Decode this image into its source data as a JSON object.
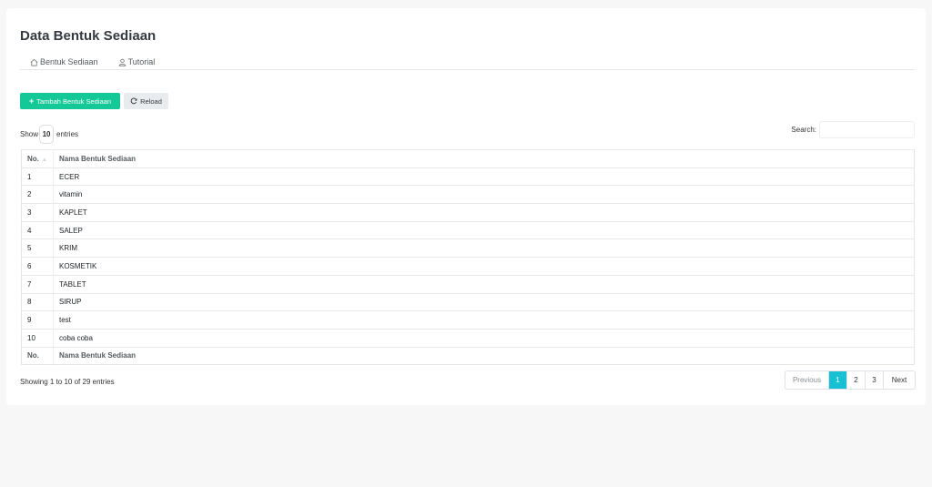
{
  "page": {
    "title": "Data Bentuk Sediaan"
  },
  "breadcrumb": [
    {
      "label": "Bentuk Sediaan",
      "icon": "home-icon"
    },
    {
      "label": "Tutorial",
      "icon": "user-icon"
    }
  ],
  "toolbar": {
    "add_label": "Tambah Bentuk Sediaan",
    "reload_label": "Reload"
  },
  "length": {
    "prefix": "Show",
    "value": "10",
    "suffix": "entries"
  },
  "search": {
    "label": "Search:",
    "value": ""
  },
  "table": {
    "headers": [
      "No.",
      "Nama Bentuk Sediaan"
    ],
    "rows": [
      [
        "1",
        "ECER"
      ],
      [
        "2",
        "vitamin"
      ],
      [
        "3",
        "KAPLET"
      ],
      [
        "4",
        "SALEP"
      ],
      [
        "5",
        "KRIM"
      ],
      [
        "6",
        "KOSMETIK"
      ],
      [
        "7",
        "TABLET"
      ],
      [
        "8",
        "SIRUP"
      ],
      [
        "9",
        "test"
      ],
      [
        "10",
        "coba coba"
      ]
    ],
    "footer": [
      "No.",
      "Nama Bentuk Sediaan"
    ]
  },
  "info": "Showing 1 to 10 of 29 entries",
  "pagination": {
    "previous": "Previous",
    "pages": [
      "1",
      "2",
      "3"
    ],
    "next": "Next",
    "active": "1"
  },
  "colors": {
    "primary_green": "#14c897",
    "active_page": "#17c1d3"
  }
}
